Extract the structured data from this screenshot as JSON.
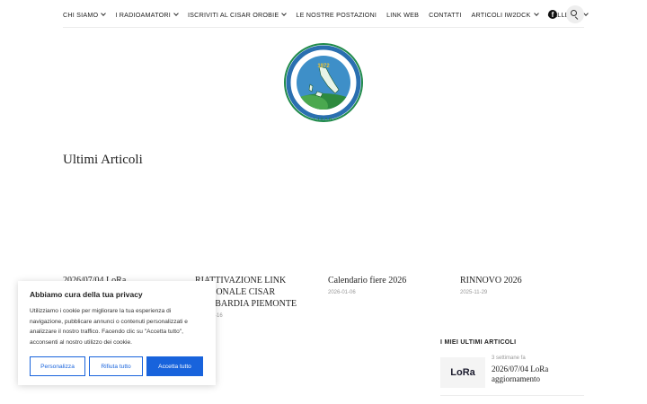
{
  "nav": {
    "items": [
      {
        "label": "CHI SIAMO",
        "dropdown": true
      },
      {
        "label": "I RADIOAMATORI",
        "dropdown": true
      },
      {
        "label": "ISCRIVITI AL CISAR OROBIE",
        "dropdown": true
      },
      {
        "label": "LE NOSTRE POSTAZIONI",
        "dropdown": false
      },
      {
        "label": "LINK WEB",
        "dropdown": false
      },
      {
        "label": "CONTATTI",
        "dropdown": false
      },
      {
        "label": "ARTICOLI IW2DCK",
        "dropdown": true
      },
      {
        "label": "GALLERIA",
        "dropdown": true
      }
    ],
    "icons": [
      "facebook-icon",
      "search-icon"
    ]
  },
  "logo": {
    "ring_text": "ASSOCIAZIONE NAZIONALE RADIOAMATORI",
    "bottom_text": "C.I.S.A.R.",
    "year_text": "1972"
  },
  "main": {
    "section_title": "Ultimi Articoli",
    "articles": [
      {
        "title": "2026/07/04 LoRa",
        "date": ""
      },
      {
        "title": "RIATTIVAZIONE LINK REGIONALE CISAR LOMBARDIA PIEMONTE",
        "date": "2026-01-16"
      },
      {
        "title": "Calendario fiere 2026",
        "date": "2026-01-06"
      },
      {
        "title": "RINNOVO 2026",
        "date": "2025-11-29"
      }
    ]
  },
  "sidebar": {
    "widget_title": "I MIEI ULTIMI ARTICOLI",
    "item": {
      "thumb_label": "LoRa",
      "meta": "3 settimane fa",
      "title": "2026/07/04 LoRa aggiornamento"
    }
  },
  "cookie": {
    "title": "Abbiamo cura della tua privacy",
    "text": "Utilizziamo i cookie per migliorare la tua esperienza di navigazione, pubblicare annunci o contenuti personalizzati e analizzare il nostro traffico. Facendo clic su \"Accetta tutto\", acconsenti al nostro utilizzo dei cookie.",
    "buttons": {
      "customize": "Personalizza",
      "reject": "Rifiuta tutto",
      "accept": "Accetta tutto"
    },
    "accent": "#1863dc"
  }
}
